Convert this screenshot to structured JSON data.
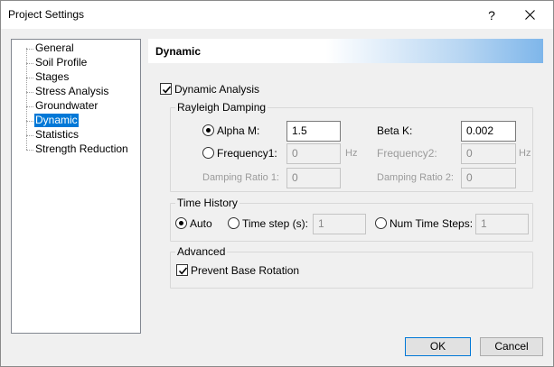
{
  "window": {
    "title": "Project Settings",
    "help_label": "?"
  },
  "tree": {
    "items": [
      {
        "label": "General"
      },
      {
        "label": "Soil Profile"
      },
      {
        "label": "Stages"
      },
      {
        "label": "Stress Analysis"
      },
      {
        "label": "Groundwater"
      },
      {
        "label": "Dynamic"
      },
      {
        "label": "Statistics"
      },
      {
        "label": "Strength Reduction"
      }
    ],
    "selected": "Dynamic"
  },
  "panel": {
    "header": "Dynamic",
    "dynamic_analysis": {
      "label": "Dynamic Analysis",
      "checked": true
    },
    "rayleigh": {
      "title": "Rayleigh Damping",
      "alpha_label": "Alpha M:",
      "alpha_value": "1.5",
      "beta_label": "Beta K:",
      "beta_value": "0.002",
      "freq1_label": "Frequency1:",
      "freq1_value": "0",
      "freq1_unit": "Hz",
      "freq2_label": "Frequency2:",
      "freq2_value": "0",
      "freq2_unit": "Hz",
      "damp1_label": "Damping Ratio 1:",
      "damp1_value": "0",
      "damp2_label": "Damping Ratio 2:",
      "damp2_value": "0",
      "selected": "alpha"
    },
    "time_history": {
      "title": "Time History",
      "auto_label": "Auto",
      "timestep_label": "Time step (s):",
      "timestep_value": "1",
      "numsteps_label": "Num Time Steps:",
      "numsteps_value": "1",
      "selected": "auto"
    },
    "advanced": {
      "title": "Advanced",
      "prevent_base_label": "Prevent Base Rotation",
      "prevent_base_checked": true
    }
  },
  "buttons": {
    "ok": "OK",
    "cancel": "Cancel"
  }
}
